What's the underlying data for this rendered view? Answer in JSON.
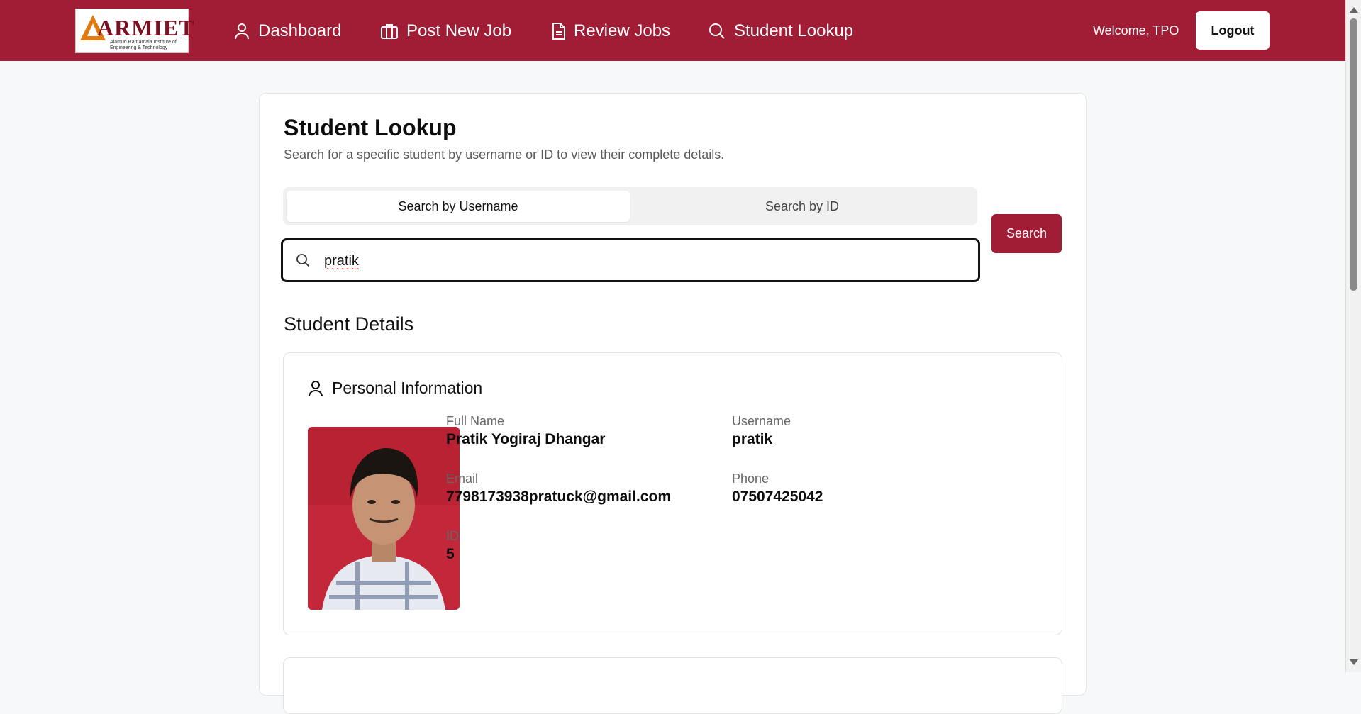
{
  "brand": {
    "logo_text": "ARMIET",
    "logo_subtext": "Alamuri Ratnamala Institute of Engineering & Technology",
    "color": "#a11c35"
  },
  "nav": {
    "items": [
      {
        "label": "Dashboard",
        "icon": "user-icon"
      },
      {
        "label": "Post New Job",
        "icon": "briefcase-icon"
      },
      {
        "label": "Review Jobs",
        "icon": "document-icon"
      },
      {
        "label": "Student Lookup",
        "icon": "search-icon"
      }
    ],
    "welcome": "Welcome, TPO",
    "logout_label": "Logout"
  },
  "page": {
    "title": "Student Lookup",
    "description": "Search for a specific student by username or ID to view their complete details.",
    "tabs": [
      {
        "label": "Search by Username",
        "active": true
      },
      {
        "label": "Search by ID",
        "active": false
      }
    ],
    "search": {
      "value": "pratik",
      "button_label": "Search",
      "icon": "search-icon"
    },
    "section_title": "Student Details"
  },
  "student": {
    "card_title": "Personal Information",
    "photo": "student-photo",
    "full_name": {
      "label": "Full Name",
      "value": "Pratik Yogiraj Dhangar"
    },
    "username": {
      "label": "Username",
      "value": "pratik"
    },
    "email": {
      "label": "Email",
      "value": "7798173938pratuck@gmail.com"
    },
    "phone": {
      "label": "Phone",
      "value": "07507425042"
    },
    "id": {
      "label": "ID",
      "value": "5"
    }
  }
}
